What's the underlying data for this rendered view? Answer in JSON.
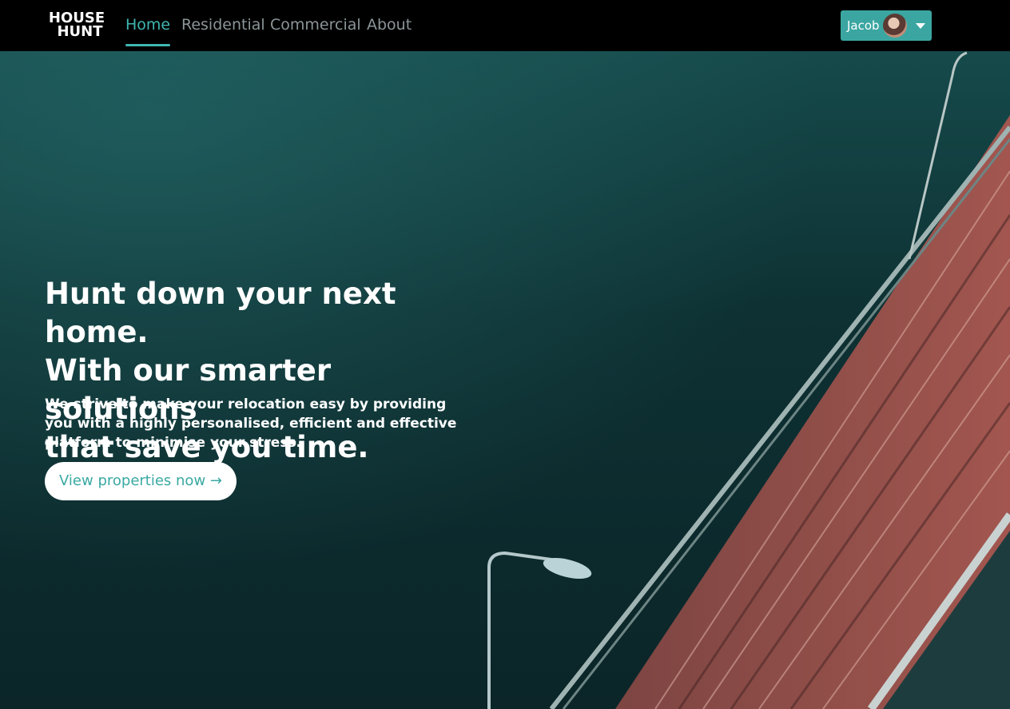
{
  "brand": {
    "line1": "HOUSE",
    "line2": "HUNT"
  },
  "nav": {
    "items": [
      {
        "label": "Home"
      },
      {
        "label": "Residential"
      },
      {
        "label": "Commercial"
      },
      {
        "label": "About"
      }
    ],
    "active": "Home"
  },
  "user": {
    "name": "Jacob"
  },
  "hero": {
    "headline_line1": "Hunt down your next home.",
    "headline_line2": "With our smarter solutions",
    "headline_line3": "that save you time.",
    "subtext": "We strive to make your relocation easy by providing you with a highly personalised, efficient and effective platform to minimise your stress.",
    "cta_label": "View properties now →"
  },
  "colors": {
    "accent": "#3fb6b0",
    "button": "#3ba6a1",
    "navbar": "#000000"
  }
}
